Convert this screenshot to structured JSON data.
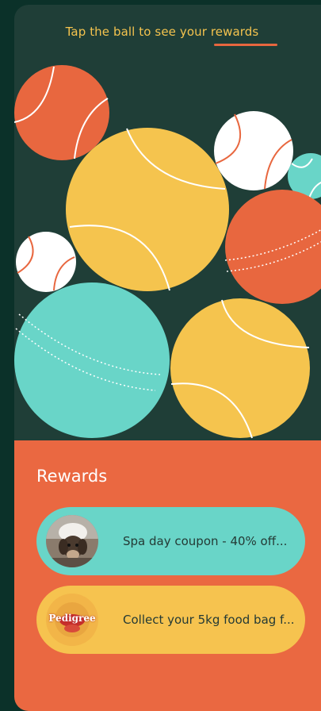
{
  "header": {
    "instruction": "Tap the ball to see your rewards"
  },
  "colors": {
    "background": "#0b3129",
    "panel": "#1f3e37",
    "accent_orange": "#ea6841",
    "accent_yellow": "#f6c34f",
    "accent_teal": "#69d5c8",
    "header_text": "#f4c34e"
  },
  "balls": [
    {
      "name": "orange-tennis-ball",
      "color": "#e8673f",
      "style": "tennis"
    },
    {
      "name": "large-yellow-tennis-ball",
      "color": "#f5c44e",
      "style": "tennis"
    },
    {
      "name": "white-baseball",
      "color": "#ffffff",
      "style": "baseball"
    },
    {
      "name": "small-teal-ball",
      "color": "#69d5c8",
      "style": "tennis"
    },
    {
      "name": "orange-cricket-ball",
      "color": "#e8673f",
      "style": "cricket"
    },
    {
      "name": "small-white-baseball",
      "color": "#ffffff",
      "style": "baseball"
    },
    {
      "name": "large-teal-cricket-ball",
      "color": "#69d5c8",
      "style": "cricket"
    },
    {
      "name": "yellow-tennis-ball",
      "color": "#f5c44e",
      "style": "tennis"
    }
  ],
  "rewards": {
    "title": "Rewards",
    "items": [
      {
        "label": "Spa day coupon - 40% off...",
        "thumbnail": "dog-photo",
        "color": "#69d5c8"
      },
      {
        "label": "Collect your 5kg food bag f...",
        "thumbnail": "pedigree-logo",
        "brand_text": "Pedigree",
        "color": "#f6c34f"
      }
    ]
  }
}
